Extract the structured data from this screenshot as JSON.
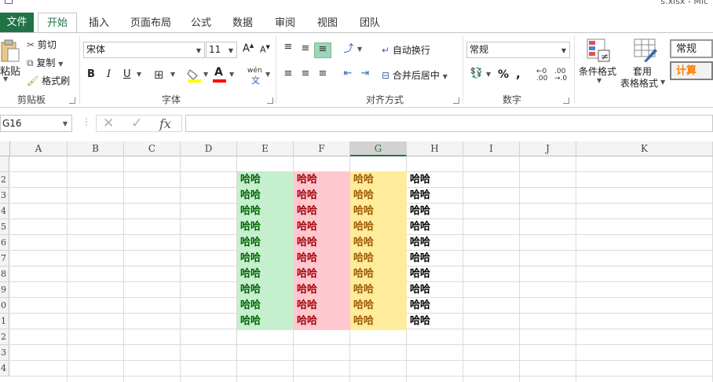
{
  "window": {
    "file_title": "s.xlsx - Mic"
  },
  "tabs": [
    {
      "label": "文件"
    },
    {
      "label": "开始"
    },
    {
      "label": "插入"
    },
    {
      "label": "页面布局"
    },
    {
      "label": "公式"
    },
    {
      "label": "数据"
    },
    {
      "label": "审阅"
    },
    {
      "label": "视图"
    },
    {
      "label": "团队"
    }
  ],
  "ribbon": {
    "clipboard": {
      "paste": "粘贴",
      "cut": "剪切",
      "copy": "复制",
      "format_painter": "格式刷",
      "label": "剪贴板"
    },
    "font": {
      "name": "宋体",
      "size": "11",
      "grow": "A",
      "shrink": "A",
      "bold": "B",
      "italic": "I",
      "underline": "U",
      "fill_letter": "",
      "font_color_letter": "A",
      "phonetic": "wén",
      "label": "字体",
      "fill_color": "#ffff00",
      "font_color": "#ff0000"
    },
    "alignment": {
      "wrap_text": "自动换行",
      "merge_center": "合并后居中",
      "label": "对齐方式"
    },
    "number": {
      "format": "常规",
      "percent": "%",
      "comma": ",",
      "label": "数字"
    },
    "styles": {
      "conditional": "条件格式",
      "table_format_line1": "套用",
      "table_format_line2": "表格格式",
      "style_normal": "常规",
      "style_calc": "计算"
    }
  },
  "formula_bar": {
    "name_box": "G16",
    "fx": "fx",
    "formula": ""
  },
  "sheet": {
    "columns": [
      "A",
      "B",
      "C",
      "D",
      "E",
      "F",
      "G",
      "H",
      "I",
      "J",
      "K"
    ],
    "selected_column": "G",
    "row_numbers": [
      "",
      "",
      "",
      "",
      "",
      "",
      "",
      "",
      "",
      "",
      "",
      "",
      "",
      "",
      ""
    ],
    "row_numbers_visible": [
      "2",
      "3",
      "4",
      "5",
      "6",
      "7",
      "8",
      "9",
      "0",
      "1",
      "2",
      "3",
      "4"
    ],
    "cell_text": "哈哈",
    "data_rows": 10,
    "styles": {
      "E": {
        "bg": "#c6efce",
        "fg": "#006100"
      },
      "F": {
        "bg": "#ffc7ce",
        "fg": "#9c0006"
      },
      "G": {
        "bg": "#ffeb9c",
        "fg": "#9c5700"
      },
      "H": {
        "bg": "#ffffff",
        "fg": "#000000"
      }
    }
  }
}
